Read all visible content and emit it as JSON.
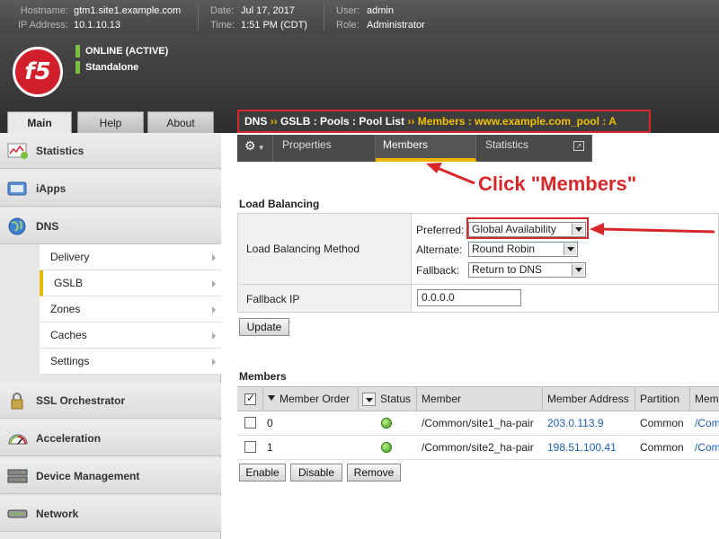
{
  "banner": {
    "hostname_label": "Hostname:",
    "hostname": "gtm1.site1.example.com",
    "ip_label": "IP Address:",
    "ip": "10.1.10.13",
    "date_label": "Date:",
    "date": "Jul 17, 2017",
    "time_label": "Time:",
    "time": "1:51 PM (CDT)",
    "user_label": "User:",
    "user": "admin",
    "role_label": "Role:",
    "role": "Administrator"
  },
  "status": {
    "online": "ONLINE (ACTIVE)",
    "mode": "Standalone",
    "logo": "f5"
  },
  "tabs": {
    "main": "Main",
    "help": "Help",
    "about": "About"
  },
  "nav": {
    "statistics": "Statistics",
    "iapps": "iApps",
    "dns": "DNS",
    "dns_sub": [
      "Delivery",
      "GSLB",
      "Zones",
      "Caches",
      "Settings"
    ],
    "ssl": "SSL Orchestrator",
    "acceleration": "Acceleration",
    "device_mgmt": "Device Management",
    "network": "Network"
  },
  "breadcrumb": {
    "dns": "DNS",
    "sep": "››",
    "gslb": "GSLB : Pools : Pool List",
    "current": "Members : www.example.com_pool : A"
  },
  "subtabs": {
    "properties": "Properties",
    "members": "Members",
    "statistics": "Statistics"
  },
  "annotation": "Click \"Members\"",
  "load_balancing": {
    "title": "Load Balancing",
    "method_label": "Load Balancing Method",
    "preferred_label": "Preferred:",
    "preferred": "Global Availability",
    "alternate_label": "Alternate:",
    "alternate": "Round Robin",
    "fallback_label": "Fallback:",
    "fallback": "Return to DNS",
    "fallback_ip_label": "Fallback IP",
    "fallback_ip": "0.0.0.0",
    "update_button": "Update"
  },
  "members": {
    "title": "Members",
    "columns": [
      "Member Order",
      "Status",
      "Member",
      "Member Address",
      "Partition",
      "Mem"
    ],
    "rows": [
      {
        "order": "0",
        "member": "/Common/site1_ha-pair",
        "address": "203.0.113.9",
        "partition": "Common",
        "more": "/Com"
      },
      {
        "order": "1",
        "member": "/Common/site2_ha-pair",
        "address": "198.51.100.41",
        "partition": "Common",
        "more": "/Com"
      }
    ],
    "buttons": {
      "enable": "Enable",
      "disable": "Disable",
      "remove": "Remove"
    }
  }
}
